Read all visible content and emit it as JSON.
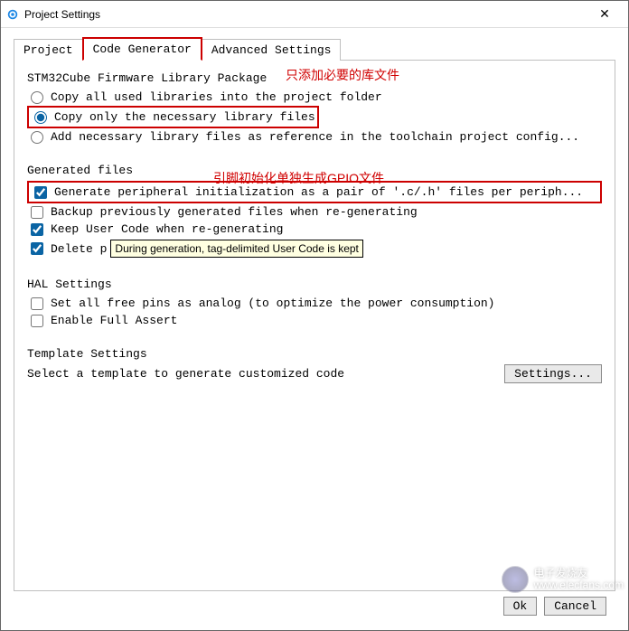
{
  "window": {
    "title": "Project Settings",
    "close_glyph": "✕"
  },
  "tabs": {
    "project": "Project",
    "codegen": "Code Generator",
    "advanced": "Advanced Settings"
  },
  "annotations": {
    "lib_note": "只添加必要的库文件",
    "gpio_note": "引脚初始化单独生成GPIO文件"
  },
  "firmware": {
    "title": "STM32Cube Firmware Library Package",
    "opt_copy_all": "Copy all used libraries into the project folder",
    "opt_copy_necessary": "Copy only the necessary library files",
    "opt_add_ref": "Add necessary library files as reference in the toolchain project config..."
  },
  "generated": {
    "title": "Generated files",
    "opt_pair": "Generate peripheral initialization as a pair of '.c/.h' files per periph...",
    "opt_backup": "Backup previously generated files when re-generating",
    "opt_keep_user": "Keep User Code when re-generating",
    "opt_delete_prefix": "Delete p",
    "tooltip": "During generation, tag-delimited User Code is kept"
  },
  "hal": {
    "title": "HAL Settings",
    "opt_analog": "Set all free pins as analog (to optimize the power consumption)",
    "opt_assert": "Enable Full Assert"
  },
  "template": {
    "title": "Template Settings",
    "desc": "Select a template to generate customized code",
    "settings_btn": "Settings..."
  },
  "footer": {
    "ok": "Ok",
    "cancel": "Cancel"
  },
  "watermark": {
    "line1": "电子发烧友",
    "line2": "www.elecfans.com"
  }
}
